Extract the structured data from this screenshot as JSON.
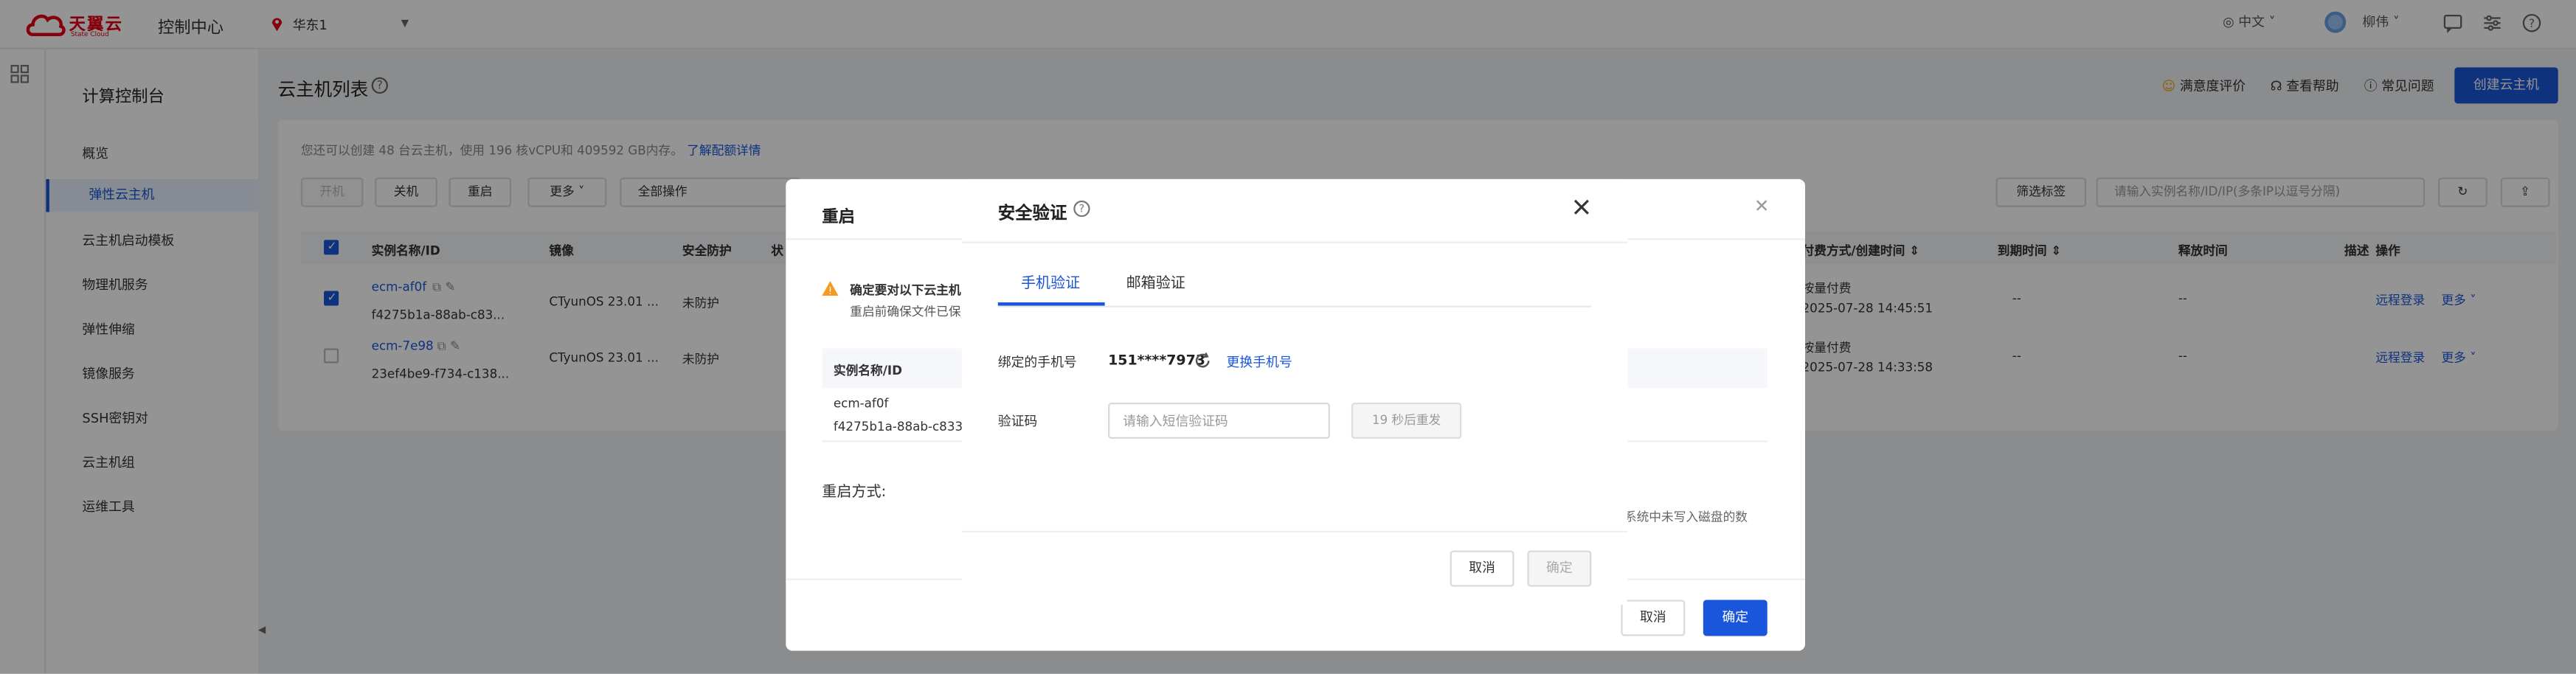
{
  "topbar": {
    "logo_text": "天翼云",
    "logo_sub": "State Cloud",
    "console": "控制中心",
    "region": "华东1",
    "lang": "中文",
    "user": "柳伟"
  },
  "sidebar": {
    "title": "计算控制台",
    "items": [
      {
        "label": "概览"
      },
      {
        "label": "弹性云主机"
      },
      {
        "label": "云主机启动模板"
      },
      {
        "label": "物理机服务"
      },
      {
        "label": "弹性伸缩"
      },
      {
        "label": "镜像服务"
      },
      {
        "label": "SSH密钥对"
      },
      {
        "label": "云主机组"
      },
      {
        "label": "运维工具"
      }
    ]
  },
  "page": {
    "title": "云主机列表",
    "links": {
      "survey": "满意度评价",
      "help": "查看帮助",
      "faq": "常见问题"
    },
    "create_button": "创建云主机",
    "quota_note": "您还可以创建 48 台云主机，使用 196 核vCPU和 409592 GB内存。",
    "quota_link": "了解配额详情",
    "toolbar": {
      "start": "开机",
      "stop": "关机",
      "reboot": "重启",
      "more": "更多",
      "all_ops": "全部操作",
      "filter_tag": "筛选标签",
      "search_placeholder": "请输入实例名称/ID/IP(多条IP以逗号分隔)"
    },
    "columns": {
      "name": "实例名称/ID",
      "image": "镜像",
      "protect": "安全防护",
      "status": "状",
      "billing": "付费方式/创建时间",
      "expire": "到期时间",
      "release": "释放时间",
      "desc": "描述",
      "ops": "操作"
    },
    "rows": [
      {
        "name": "ecm-af0f",
        "id": "f4275b1a-88ab-c83...",
        "image": "CTyunOS 23.01 ...",
        "protect": "未防护",
        "billing": "按量付费",
        "created": "2025-07-28 14:45:51",
        "expire": "--",
        "release": "--",
        "remote": "远程登录",
        "more": "更多"
      },
      {
        "name": "ecm-7e98",
        "id": "23ef4be9-f734-c138...",
        "image": "CTyunOS 23.01 ...",
        "protect": "未防护",
        "billing": "按量付费",
        "created": "2025-07-28 14:33:58",
        "expire": "--",
        "release": "--",
        "remote": "远程登录",
        "more": "更多"
      }
    ]
  },
  "reboot_dialog": {
    "title": "重启",
    "warning": "确定要对以下云主机",
    "warning_sub": "重启前确保文件已保",
    "table_header": "实例名称/ID",
    "instance_name": "ecm-af0f",
    "instance_id": "f4275b1a-88ab-c833",
    "mode_label": "重启方式:",
    "tail_text": "系统中未写入磁盘的数",
    "cancel": "取消",
    "confirm": "确定"
  },
  "security_dialog": {
    "title": "安全验证",
    "tabs": [
      "手机验证",
      "邮箱验证"
    ],
    "phone_label": "绑定的手机号",
    "phone": "151****7973",
    "change_phone": "更换手机号",
    "code_label": "验证码",
    "code_placeholder": "请输入短信验证码",
    "resend": "19 秒后重发",
    "cancel": "取消",
    "confirm": "确定"
  }
}
